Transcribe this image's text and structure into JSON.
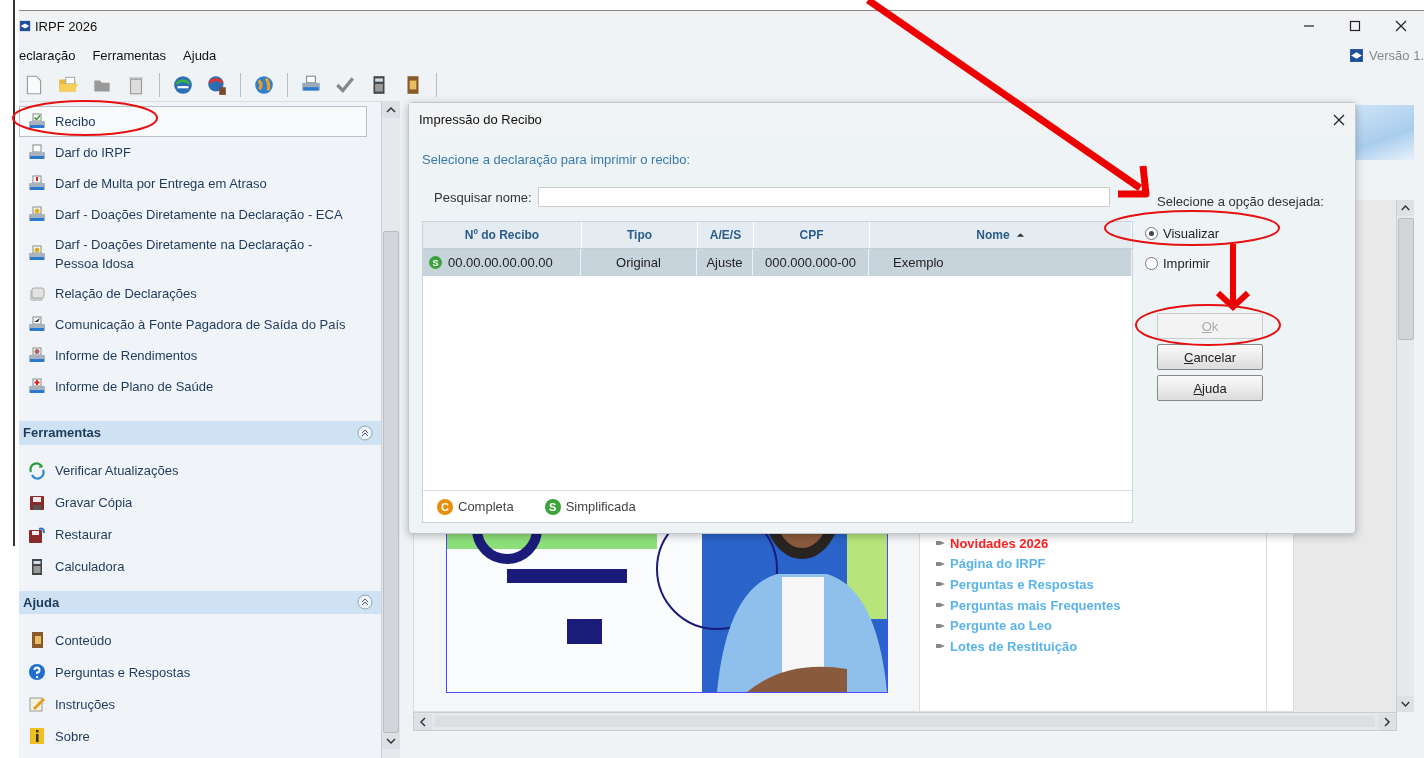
{
  "window": {
    "title": "IRPF 2026",
    "version": "Versão 1."
  },
  "menu": [
    "eclaração",
    "Ferramentas",
    "Ajuda"
  ],
  "sidebar": {
    "items": [
      {
        "label": "Recibo",
        "selected": true
      },
      {
        "label": "Darf do IRPF",
        "selected": false
      },
      {
        "label": "Darf de Multa por Entrega em Atraso",
        "selected": false
      },
      {
        "label": "Darf - Doações Diretamente na Declaração - ECA",
        "selected": false
      },
      {
        "label": "Darf - Doações Diretamente na Declaração - Pessoa Idosa",
        "selected": false
      },
      {
        "label": "Relação de Declarações",
        "selected": false
      },
      {
        "label": "Comunicação à Fonte Pagadora de Saída do País",
        "selected": false
      },
      {
        "label": "Informe de Rendimentos",
        "selected": false
      },
      {
        "label": "Informe de Plano de Saúde",
        "selected": false
      }
    ],
    "sections": [
      {
        "title": "Ferramentas",
        "expanded": true,
        "items": [
          "Verificar Atualizações",
          "Gravar Cópia",
          "Restaurar",
          "Calculadora"
        ]
      },
      {
        "title": "Ajuda",
        "expanded": true,
        "items": [
          "Conteúdo",
          "Perguntas e Respostas",
          "Instruções",
          "Sobre"
        ]
      }
    ]
  },
  "links": [
    {
      "label": "Novidades 2026",
      "color": "#ff2020"
    },
    {
      "label": "Página do IRPF",
      "color": "#5ab4ea"
    },
    {
      "label": "Perguntas e Respostas",
      "color": "#5ab4ea"
    },
    {
      "label": "Perguntas mais Frequentes",
      "color": "#5ab4ea"
    },
    {
      "label": "Pergunte ao Leo",
      "color": "#5ab4ea"
    },
    {
      "label": "Lotes de Restituição",
      "color": "#5ab4ea"
    }
  ],
  "dialog": {
    "title": "Impressão do Recibo",
    "prompt": "Selecione a declaração para imprimir o recibo:",
    "search": {
      "label": "Pesquisar nome:"
    },
    "table": {
      "columns": [
        {
          "label": "Nº do Recibo",
          "sorted": false
        },
        {
          "label": "Tipo",
          "sorted": false
        },
        {
          "label": "A/E/S",
          "sorted": false
        },
        {
          "label": "CPF",
          "sorted": false
        },
        {
          "label": "Nome",
          "sorted": true
        }
      ],
      "rows": [
        {
          "selected": true,
          "badge": "S",
          "color": "#3aa43a",
          "cells": [
            "00.00.00.00.00.00",
            "Original",
            "Ajuste",
            "000.000.000-00",
            "Exemplo"
          ]
        }
      ]
    },
    "legend": [
      {
        "badge": "C",
        "label": "Completa",
        "color": "#e8900c"
      },
      {
        "badge": "S",
        "label": "Simplificada",
        "color": "#3aa43a"
      }
    ],
    "options_title": "Selecione a opção desejada:",
    "options": [
      {
        "label": "Visualizar",
        "selected": true
      },
      {
        "label": "Imprimir",
        "selected": false
      }
    ],
    "buttons": [
      {
        "label": "Ok",
        "disabled": true
      },
      {
        "label": "Cancelar",
        "disabled": false
      },
      {
        "label": "Ajuda",
        "disabled": false
      }
    ]
  }
}
